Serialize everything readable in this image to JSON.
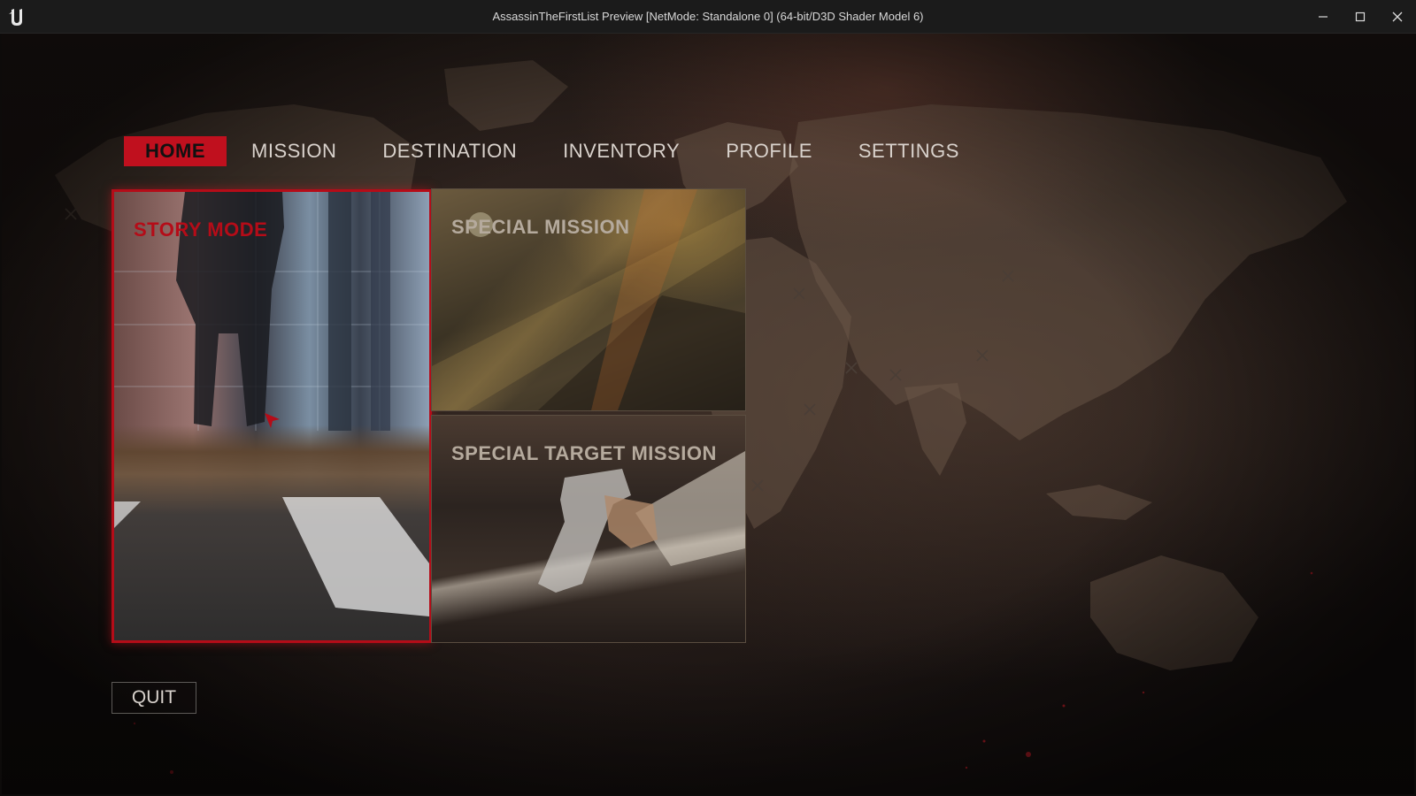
{
  "window": {
    "title": "AssassinTheFirstList Preview [NetMode: Standalone 0]  (64-bit/D3D Shader Model 6)",
    "logo_icon": "unreal-engine-logo",
    "controls": [
      "minimize-icon",
      "maximize-icon",
      "close-icon"
    ]
  },
  "nav": {
    "items": [
      {
        "label": "HOME",
        "active": true
      },
      {
        "label": "MISSION",
        "active": false
      },
      {
        "label": "DESTINATION",
        "active": false
      },
      {
        "label": "INVENTORY",
        "active": false
      },
      {
        "label": "PROFILE",
        "active": false
      },
      {
        "label": "SETTINGS",
        "active": false
      }
    ]
  },
  "cards": {
    "story": {
      "label": "STORY MODE",
      "selected": true
    },
    "special": {
      "label": "SPECIAL MISSION",
      "selected": false
    },
    "target": {
      "label": "SPECIAL TARGET MISSION",
      "selected": false
    }
  },
  "quit": {
    "label": "QUIT"
  },
  "colors": {
    "accent": "#c0101e",
    "text": "#d9d2cc",
    "card_label": "#b5aa9d",
    "background": "#1d1614"
  }
}
